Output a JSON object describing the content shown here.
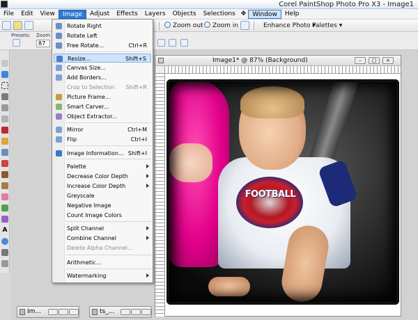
{
  "app": {
    "title": "Corel PaintShop Photo Pro X3 - Image1"
  },
  "menubar": {
    "items": [
      "File",
      "Edit",
      "View",
      "Image",
      "Adjust",
      "Effects",
      "Layers",
      "Objects",
      "Selections",
      "Window",
      "Help"
    ]
  },
  "toolbar": {
    "zoom_out": "Zoom out",
    "zoom_in": "Zoom in",
    "enhance_photo": "Enhance Photo",
    "palettes": "Palettes"
  },
  "options": {
    "presets_label": "Presets:",
    "zoom_label": "Zoom (%)",
    "zoom_value": "87"
  },
  "image_window": {
    "title": "Image1* @  87% (Background)",
    "logo_text": "FOOTBALL"
  },
  "minimized": [
    {
      "title": "Im..."
    },
    {
      "title": "ts_..."
    }
  ],
  "image_menu": {
    "items": [
      {
        "label": "Rotate Right",
        "shortcut": "",
        "submenu": false,
        "disabled": false,
        "highlight": false
      },
      {
        "label": "Rotate Left",
        "shortcut": "",
        "submenu": false,
        "disabled": false,
        "highlight": false
      },
      {
        "label": "Free Rotate...",
        "shortcut": "Ctrl+R",
        "submenu": false,
        "disabled": false,
        "highlight": false
      },
      {
        "label": "Resize...",
        "shortcut": "Shift+S",
        "submenu": false,
        "disabled": false,
        "highlight": true
      },
      {
        "label": "Canvas Size...",
        "shortcut": "",
        "submenu": false,
        "disabled": false,
        "highlight": false
      },
      {
        "label": "Add Borders...",
        "shortcut": "",
        "submenu": false,
        "disabled": false,
        "highlight": false
      },
      {
        "label": "Crop to Selection",
        "shortcut": "Shift+R",
        "submenu": false,
        "disabled": true,
        "highlight": false
      },
      {
        "label": "Picture Frame...",
        "shortcut": "",
        "submenu": false,
        "disabled": false,
        "highlight": false
      },
      {
        "label": "Smart Carver...",
        "shortcut": "",
        "submenu": false,
        "disabled": false,
        "highlight": false
      },
      {
        "label": "Object Extractor...",
        "shortcut": "",
        "submenu": false,
        "disabled": false,
        "highlight": false
      },
      {
        "label": "Mirror",
        "shortcut": "Ctrl+M",
        "submenu": false,
        "disabled": false,
        "highlight": false
      },
      {
        "label": "Flip",
        "shortcut": "Ctrl+I",
        "submenu": false,
        "disabled": false,
        "highlight": false
      },
      {
        "label": "Image Information...",
        "shortcut": "Shift+I",
        "submenu": false,
        "disabled": false,
        "highlight": false
      },
      {
        "label": "Palette",
        "shortcut": "",
        "submenu": true,
        "disabled": false,
        "highlight": false
      },
      {
        "label": "Decrease Color Depth",
        "shortcut": "",
        "submenu": true,
        "disabled": false,
        "highlight": false
      },
      {
        "label": "Increase Color Depth",
        "shortcut": "",
        "submenu": true,
        "disabled": false,
        "highlight": false
      },
      {
        "label": "Greyscale",
        "shortcut": "",
        "submenu": false,
        "disabled": false,
        "highlight": false
      },
      {
        "label": "Negative Image",
        "shortcut": "",
        "submenu": false,
        "disabled": false,
        "highlight": false
      },
      {
        "label": "Count Image Colors",
        "shortcut": "",
        "submenu": false,
        "disabled": false,
        "highlight": false
      },
      {
        "label": "Split Channel",
        "shortcut": "",
        "submenu": true,
        "disabled": false,
        "highlight": false
      },
      {
        "label": "Combine Channel",
        "shortcut": "",
        "submenu": true,
        "disabled": false,
        "highlight": false
      },
      {
        "label": "Delete Alpha Channel...",
        "shortcut": "",
        "submenu": false,
        "disabled": true,
        "highlight": false
      },
      {
        "label": "Arithmetic...",
        "shortcut": "",
        "submenu": false,
        "disabled": false,
        "highlight": false
      },
      {
        "label": "Watermarking",
        "shortcut": "",
        "submenu": true,
        "disabled": false,
        "highlight": false
      }
    ]
  },
  "colors": {
    "menu_highlight": "#cfe3fc",
    "active_menu": "#2f7ad8",
    "pink_seat": "#e2008a"
  }
}
